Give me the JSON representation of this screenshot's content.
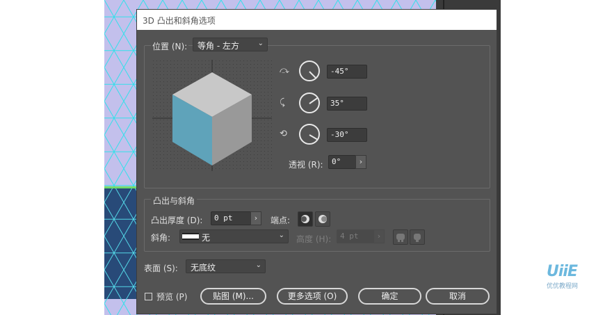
{
  "dialog": {
    "title": "3D 凸出和斜角选项"
  },
  "position": {
    "label": "位置 (N):",
    "value": "等角 - 左方"
  },
  "rotation": {
    "x_value": "-45°",
    "y_value": "35°",
    "z_value": "-30°",
    "perspective_label": "透视 (R):",
    "perspective_value": "0°"
  },
  "extrude": {
    "section_label": "凸出与斜角",
    "depth_label": "凸出厚度 (D):",
    "depth_value": "0 pt",
    "cap_label": "端点:",
    "bevel_label": "斜角:",
    "bevel_value": "无",
    "height_label": "高度 (H):",
    "height_value": "4 pt"
  },
  "surface": {
    "label": "表面 (S):",
    "value": "无底纹"
  },
  "footer": {
    "preview_label": "预览 (P)",
    "map_art_label": "贴图 (M)...",
    "more_options_label": "更多选项 (O)",
    "ok_label": "确定",
    "cancel_label": "取消"
  },
  "watermark": {
    "logo": "UiiE",
    "text": "优优教程网"
  },
  "colors": {
    "dialog_bg": "#535353",
    "cube_top": "#c8c8c8",
    "cube_left": "#5fa3ba",
    "cube_right": "#999999",
    "canvas_bg": "#c3c0ec",
    "grid_line": "#33e0ea"
  },
  "icons": {
    "rotate_x": "rotate-x-axis-icon",
    "rotate_y": "rotate-y-axis-icon",
    "rotate_z": "rotate-z-axis-icon",
    "cap_on": "cap-on-icon",
    "cap_off": "cap-off-icon",
    "bevel_out": "bevel-out-icon",
    "bevel_in": "bevel-in-icon"
  }
}
